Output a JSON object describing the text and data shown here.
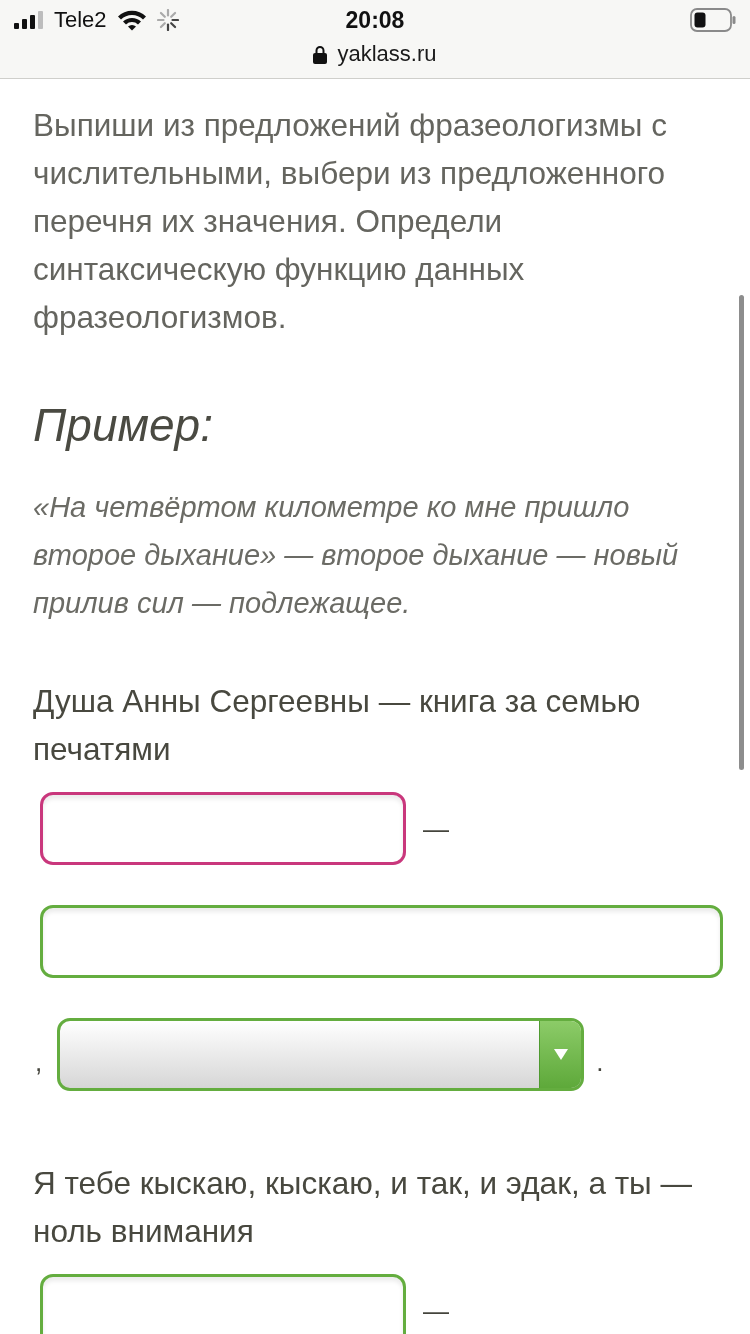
{
  "status_bar": {
    "carrier": "Tele2",
    "time": "20:08"
  },
  "address_bar": {
    "url": "yaklass.ru"
  },
  "instruction": "Выпиши из предложений фразеологизмы с числительными, выбери из предложенного перечня их значения. Определи синтаксическую функцию данных фразеологизмов.",
  "example": {
    "heading": "Пример:",
    "text": "«На четвёртом километре ко мне пришло второе дыхание» — второе дыхание — новый прилив сил — подлежащее."
  },
  "questions": [
    {
      "sentence": "Душа Анны Сергеевны — книга за семью печатями",
      "rows": [
        [
          {
            "kind": "input",
            "highlighted": true
          },
          {
            "kind": "mark",
            "text": "—"
          }
        ],
        [
          {
            "kind": "input",
            "highlighted": false
          }
        ],
        [
          {
            "kind": "mark",
            "text": ","
          },
          {
            "kind": "select",
            "highlighted": false
          },
          {
            "kind": "mark",
            "text": "."
          }
        ]
      ]
    },
    {
      "sentence": "Я тебе кыскаю, кыскаю, и так, и эдак, а ты — ноль внимания",
      "rows": [
        [
          {
            "kind": "input",
            "highlighted": false
          },
          {
            "kind": "mark",
            "text": "—"
          }
        ]
      ]
    }
  ]
}
